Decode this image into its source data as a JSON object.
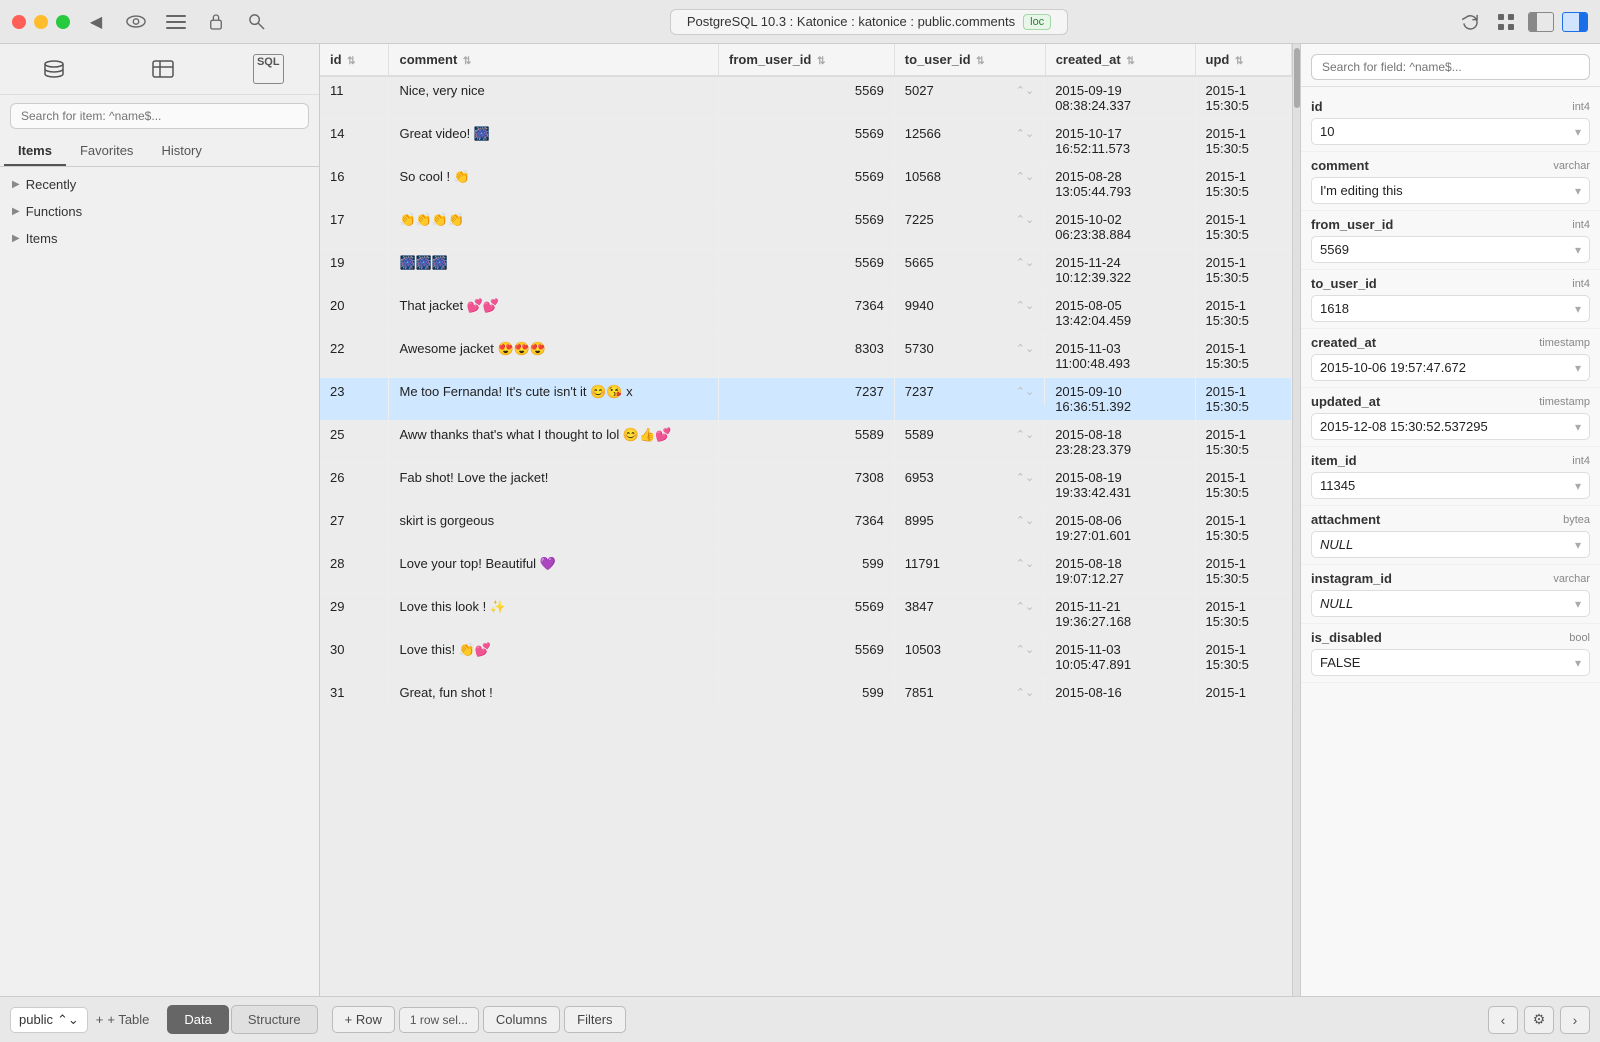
{
  "titlebar": {
    "connection_text": "PostgreSQL 10.3 : Katonice : katonice : public.comments",
    "loc_label": "loc",
    "icons": {
      "back": "◀",
      "eye": "👁",
      "list": "☰",
      "lock": "🔒",
      "search": "🔍"
    }
  },
  "sidebar": {
    "search_placeholder": "Search for item: ^name$...",
    "tabs": [
      "Items",
      "Favorites",
      "History"
    ],
    "active_tab": "Items",
    "sections": [
      {
        "label": "Recently",
        "id": "recently"
      },
      {
        "label": "Functions",
        "id": "functions"
      },
      {
        "label": "Items",
        "id": "items"
      }
    ]
  },
  "table": {
    "columns": [
      {
        "label": "id",
        "key": "id"
      },
      {
        "label": "comment",
        "key": "comment"
      },
      {
        "label": "from_user_id",
        "key": "from_user_id"
      },
      {
        "label": "to_user_id",
        "key": "to_user_id"
      },
      {
        "label": "created_at",
        "key": "created_at"
      },
      {
        "label": "upd",
        "key": "upd"
      }
    ],
    "rows": [
      {
        "id": 11,
        "comment": "Nice, very nice",
        "from_user_id": 5569,
        "to_user_id": 5027,
        "created_at": "2015-09-19\n08:38:24.337",
        "upd": "2015-1\n15:30:5",
        "selected": false
      },
      {
        "id": 14,
        "comment": "Great video! 🎆",
        "from_user_id": 5569,
        "to_user_id": 12566,
        "created_at": "2015-10-17\n16:52:11.573",
        "upd": "2015-1\n15:30:5",
        "selected": false
      },
      {
        "id": 16,
        "comment": "So cool ! 👏",
        "from_user_id": 5569,
        "to_user_id": 10568,
        "created_at": "2015-08-28\n13:05:44.793",
        "upd": "2015-1\n15:30:5",
        "selected": false
      },
      {
        "id": 17,
        "comment": "👏👏👏👏",
        "from_user_id": 5569,
        "to_user_id": 7225,
        "created_at": "2015-10-02\n06:23:38.884",
        "upd": "2015-1\n15:30:5",
        "selected": false
      },
      {
        "id": 19,
        "comment": "🎆🎆🎆",
        "from_user_id": 5569,
        "to_user_id": 5665,
        "created_at": "2015-11-24\n10:12:39.322",
        "upd": "2015-1\n15:30:5",
        "selected": false
      },
      {
        "id": 20,
        "comment": "That jacket 💕💕",
        "from_user_id": 7364,
        "to_user_id": 9940,
        "created_at": "2015-08-05\n13:42:04.459",
        "upd": "2015-1\n15:30:5",
        "selected": false
      },
      {
        "id": 22,
        "comment": "Awesome jacket 😍😍😍",
        "from_user_id": 8303,
        "to_user_id": 5730,
        "created_at": "2015-11-03\n11:00:48.493",
        "upd": "2015-1\n15:30:5",
        "selected": false
      },
      {
        "id": 23,
        "comment": "Me too Fernanda! It's cute isn't it 😊😘 x",
        "from_user_id": 7237,
        "to_user_id": 7237,
        "created_at": "2015-09-10\n16:36:51.392",
        "upd": "2015-1\n15:30:5",
        "selected": true
      },
      {
        "id": 25,
        "comment": "Aww thanks that's what I thought to lol 😊👍💕",
        "from_user_id": 5589,
        "to_user_id": 5589,
        "created_at": "2015-08-18\n23:28:23.379",
        "upd": "2015-1\n15:30:5",
        "selected": false
      },
      {
        "id": 26,
        "comment": "Fab shot! Love the jacket!",
        "from_user_id": 7308,
        "to_user_id": 6953,
        "created_at": "2015-08-19\n19:33:42.431",
        "upd": "2015-1\n15:30:5",
        "selected": false
      },
      {
        "id": 27,
        "comment": "skirt is gorgeous",
        "from_user_id": 7364,
        "to_user_id": 8995,
        "created_at": "2015-08-06\n19:27:01.601",
        "upd": "2015-1\n15:30:5",
        "selected": false
      },
      {
        "id": 28,
        "comment": "Love your top! Beautiful 💜",
        "from_user_id": 599,
        "to_user_id": 11791,
        "created_at": "2015-08-18\n19:07:12.27",
        "upd": "2015-1\n15:30:5",
        "selected": false
      },
      {
        "id": 29,
        "comment": "Love this look ! ✨",
        "from_user_id": 5569,
        "to_user_id": 3847,
        "created_at": "2015-11-21\n19:36:27.168",
        "upd": "2015-1\n15:30:5",
        "selected": false
      },
      {
        "id": 30,
        "comment": "Love this! 👏💕",
        "from_user_id": 5569,
        "to_user_id": 10503,
        "created_at": "2015-11-03\n10:05:47.891",
        "upd": "2015-1\n15:30:5",
        "selected": false
      },
      {
        "id": 31,
        "comment": "Great, fun shot !",
        "from_user_id": 599,
        "to_user_id": 7851,
        "created_at": "2015-08-16",
        "upd": "2015-1",
        "selected": false
      }
    ]
  },
  "right_panel": {
    "search_placeholder": "Search for field: ^name$...",
    "fields": [
      {
        "name": "id",
        "type": "int4",
        "value": "10",
        "null": false
      },
      {
        "name": "comment",
        "type": "varchar",
        "value": "I'm editing this",
        "null": false
      },
      {
        "name": "from_user_id",
        "type": "int4",
        "value": "5569",
        "null": false
      },
      {
        "name": "to_user_id",
        "type": "int4",
        "value": "1618",
        "null": false
      },
      {
        "name": "created_at",
        "type": "timestamp",
        "value": "2015-10-06 19:57:47.672",
        "null": false
      },
      {
        "name": "updated_at",
        "type": "timestamp",
        "value": "2015-12-08 15:30:52.537295",
        "null": false
      },
      {
        "name": "item_id",
        "type": "int4",
        "value": "11345",
        "null": false
      },
      {
        "name": "attachment",
        "type": "bytea",
        "value": "NULL",
        "null": true
      },
      {
        "name": "instagram_id",
        "type": "varchar",
        "value": "NULL",
        "null": true
      },
      {
        "name": "is_disabled",
        "type": "bool",
        "value": "FALSE",
        "null": false
      }
    ]
  },
  "bottom_bar": {
    "schema_label": "public",
    "add_table_label": "+ Table",
    "tabs": [
      {
        "label": "Data",
        "active": true
      },
      {
        "label": "Structure",
        "active": false
      }
    ],
    "actions": [
      {
        "label": "+ Row"
      },
      {
        "label": "1 row sel..."
      },
      {
        "label": "Columns"
      },
      {
        "label": "Filters"
      }
    ],
    "nav": {
      "prev": "‹",
      "next": "›",
      "settings": "⚙"
    }
  }
}
